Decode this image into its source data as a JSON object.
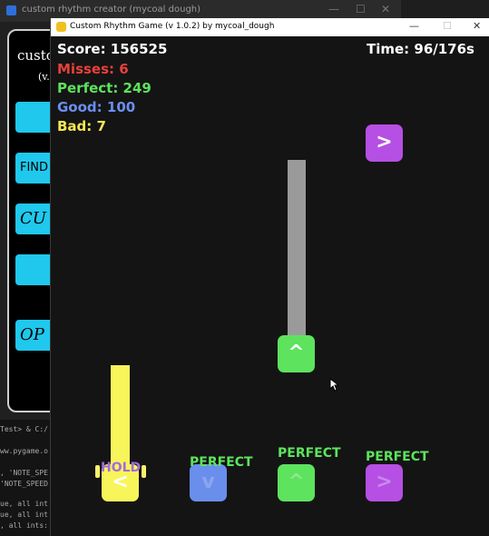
{
  "background_window": {
    "title": "custom rhythm creator (mycoal dough)",
    "panel_title": "custo",
    "version": "(v.",
    "buttons": [
      "",
      "FIND",
      "CU",
      "",
      "OP"
    ],
    "terminal_lines": [
      "Test> & C:/",
      "ww.pygame.o",
      ", 'NOTE_SPE",
      "'NOTE_SPEED",
      "ue, all int",
      "ue, all int",
      ", all ints:"
    ]
  },
  "game_window": {
    "title": "Custom Rhythm Game (v 1.0.2) by mycoal_dough",
    "controls": {
      "minimize": "—",
      "maximize": "☐",
      "close": "✕"
    }
  },
  "hud": {
    "score": "Score: 156525",
    "misses": "Misses: 6",
    "perfect": "Perfect: 249",
    "good": "Good: 100",
    "bad": "Bad: 7",
    "time": "Time: 96/176s",
    "colors": {
      "score": "#ffffff",
      "misses": "#e8403a",
      "perfect": "#5de35d",
      "good": "#6b8ff0",
      "bad": "#f5e653"
    }
  },
  "notes": {
    "falling_right": "&gt;",
    "falling_up_hold": "^",
    "lane_colors": {
      "left": "#f8f55a",
      "down": "#6a8eec",
      "up": "#5de35d",
      "right": "#b64fe4",
      "hold_trail": "#9a9a9a"
    }
  },
  "receptors": {
    "left": "<",
    "down": "v",
    "up": "^",
    "right": ">"
  },
  "judgements": {
    "left": "HOLD",
    "down": "PERFECT",
    "up": "PERFECT",
    "right": "PERFECT"
  }
}
